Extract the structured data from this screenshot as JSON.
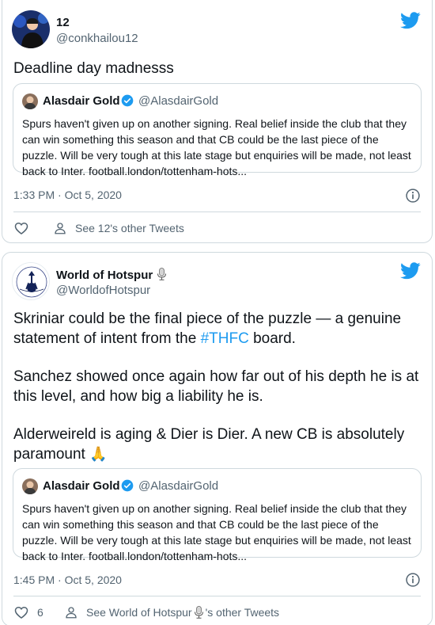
{
  "tweets": [
    {
      "display_name": "12",
      "handle": "@conkhailou12",
      "text": [
        "Deadline day madnesss"
      ],
      "quote": {
        "display_name": "Alasdair Gold",
        "handle": "@AlasdairGold",
        "text": "Spurs haven't given up on another signing. Real belief inside the club that they can win something this season and that CB could be the last piece of the puzzle. Will be very tough at this late stage but enquiries will be made, not least back to Inter. football.london/tottenham-hots..."
      },
      "timestamp": "1:33 PM · Oct 5, 2020",
      "like_count": "",
      "other_tweets_label": "See 12's other Tweets"
    },
    {
      "display_name": "World of Hotspur",
      "handle": "@WorldofHotspur",
      "text": [
        "Skriniar could be the final piece of the puzzle — a genuine statement of intent from the ",
        "#THFC",
        " board.",
        "Sanchez showed once again how far out of his depth he is at this level, and how big a liability he is.",
        "Alderweireld is aging & Dier is Dier. A new CB is absolutely paramount ",
        "🙏"
      ],
      "quote": {
        "display_name": "Alasdair Gold",
        "handle": "@AlasdairGold",
        "text": "Spurs haven't given up on another signing. Real belief inside the club that they can win something this season and that CB could be the last piece of the puzzle. Will be very tough at this late stage but enquiries will be made, not least back to Inter. football.london/tottenham-hots..."
      },
      "timestamp": "1:45 PM · Oct 5, 2020",
      "like_count": "6",
      "other_tweets_label_prefix": "See World of Hotspur",
      "other_tweets_label_suffix": "'s other Tweets"
    }
  ],
  "colors": {
    "twitter_blue": "#1d9bf0",
    "verified_blue": "#1d9bf0",
    "text": "#0f1419",
    "muted": "#536471",
    "border": "#cfd9de"
  },
  "icons": [
    "twitter-bird-icon",
    "verified-badge-icon",
    "info-icon",
    "heart-icon",
    "person-icon",
    "microphone-icon",
    "folded-hands-emoji"
  ]
}
